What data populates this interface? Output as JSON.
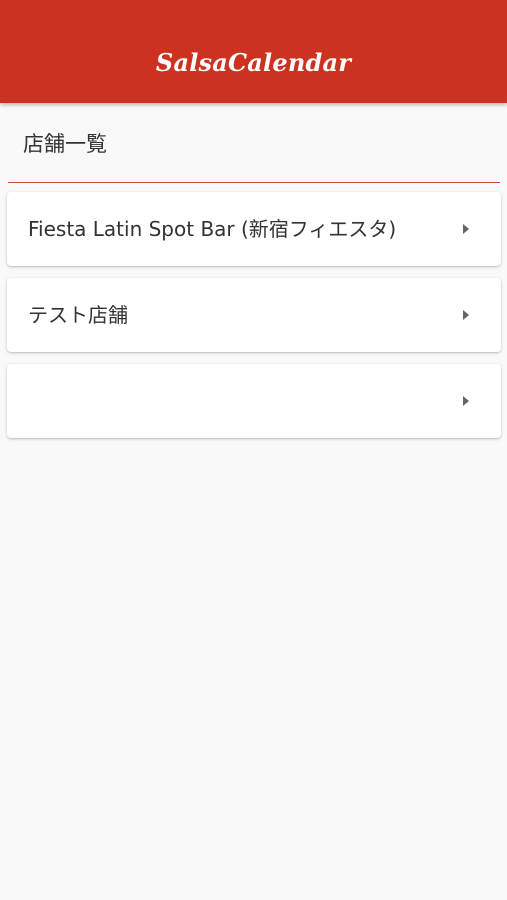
{
  "app_bar": {
    "title": "SalsaCalendar"
  },
  "page": {
    "section_title": "店舗一覧"
  },
  "stores": [
    {
      "label": "Fiesta Latin Spot Bar (新宿フィエスタ)",
      "icon": "chevron-right-icon"
    },
    {
      "label": "テスト店舗",
      "icon": "chevron-right-icon"
    },
    {
      "label": "",
      "icon": "chevron-right-icon"
    }
  ],
  "colors": {
    "accent": "#cc321f",
    "divider": "#cc4a3c",
    "background": "#f9f9f9"
  }
}
